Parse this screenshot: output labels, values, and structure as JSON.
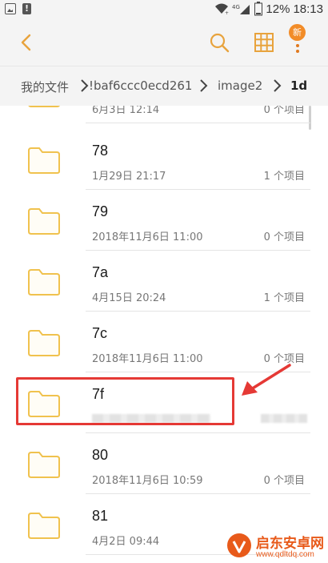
{
  "status_bar": {
    "battery": "12%",
    "time": "18:13",
    "icons": [
      "image-notification-icon",
      "alert-notification-icon",
      "wifi-icon",
      "signal-icon",
      "battery-icon"
    ]
  },
  "header": {
    "badge": "新",
    "icons": [
      "back-arrow-icon",
      "search-icon",
      "grid-view-icon",
      "more-icon"
    ],
    "accent_color": "#e8a33d",
    "badge_color": "#f28c28"
  },
  "breadcrumb": {
    "items": [
      "我的文件",
      "!baf6ccc0ecd261",
      "image2",
      "1d"
    ]
  },
  "folders": [
    {
      "name": "",
      "date": "6月3日 12:14",
      "count": "0 个项目"
    },
    {
      "name": "78",
      "date": "1月29日 21:17",
      "count": "1 个项目"
    },
    {
      "name": "79",
      "date": "2018年11月6日 11:00",
      "count": "0 个项目"
    },
    {
      "name": "7a",
      "date": "4月15日 20:24",
      "count": "1 个项目"
    },
    {
      "name": "7c",
      "date": "2018年11月6日 11:00",
      "count": "0 个项目"
    },
    {
      "name": "7f",
      "date": "",
      "count": ""
    },
    {
      "name": "80",
      "date": "2018年11月6日 10:59",
      "count": "0 个项目"
    },
    {
      "name": "81",
      "date": "4月2日 09:44",
      "count": ""
    }
  ],
  "watermark": {
    "title": "启东安卓网",
    "url": "www.qdltdq.com"
  },
  "colors": {
    "folder": "#f0c24e",
    "highlight": "#e53935",
    "arrow": "#e53935"
  }
}
